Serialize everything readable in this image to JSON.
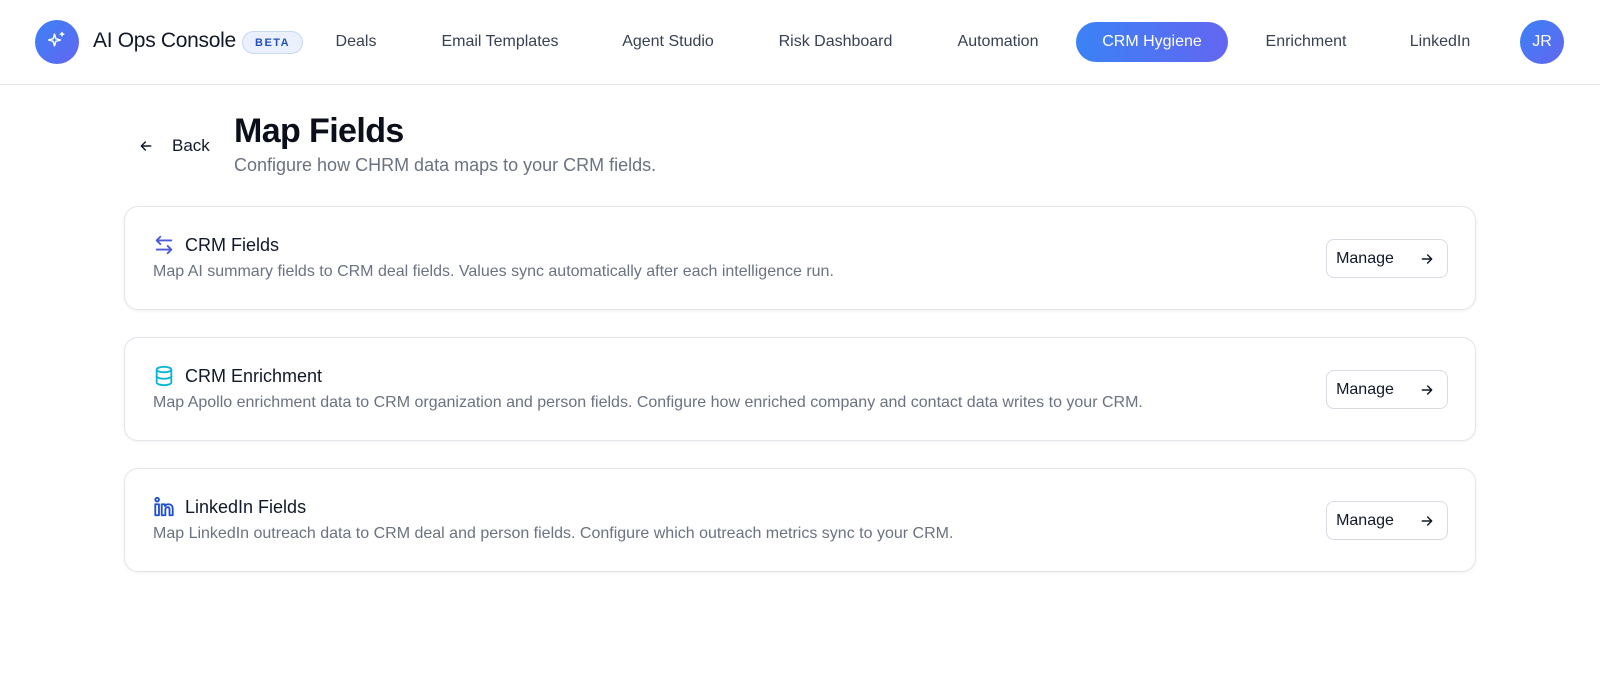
{
  "header": {
    "app_title": "AI Ops Console",
    "badge": "BETA",
    "logo_icon": "sparkles-icon",
    "nav": [
      {
        "label": "Deals",
        "active": false
      },
      {
        "label": "Email Templates",
        "active": false
      },
      {
        "label": "Agent Studio",
        "active": false
      },
      {
        "label": "Risk Dashboard",
        "active": false
      },
      {
        "label": "Automation",
        "active": false
      },
      {
        "label": "CRM Hygiene",
        "active": true
      },
      {
        "label": "Enrichment",
        "active": false
      },
      {
        "label": "LinkedIn",
        "active": false
      }
    ],
    "avatar_initials": "JR"
  },
  "page": {
    "back_label": "Back",
    "title": "Map Fields",
    "subtitle": "Configure how CHRM data maps to your CRM fields."
  },
  "cards": [
    {
      "icon": "arrows-left-right-icon",
      "title": "CRM Fields",
      "description": "Map AI summary fields to CRM deal fields. Values sync automatically after each intelligence run.",
      "button": "Manage"
    },
    {
      "icon": "database-icon",
      "title": "CRM Enrichment",
      "description": "Map Apollo enrichment data to CRM organization and person fields. Configure how enriched company and contact data writes to your CRM.",
      "button": "Manage"
    },
    {
      "icon": "linkedin-icon",
      "title": "LinkedIn Fields",
      "description": "Map LinkedIn outreach data to CRM deal and person fields. Configure which outreach metrics sync to your CRM.",
      "button": "Manage"
    }
  ],
  "colors": {
    "accent_start": "#3b82f6",
    "accent_end": "#6366f1",
    "crm_fields_icon": "#4f5bd5",
    "enrichment_icon": "#06b6d4",
    "linkedin_icon": "#1d4ed8"
  }
}
